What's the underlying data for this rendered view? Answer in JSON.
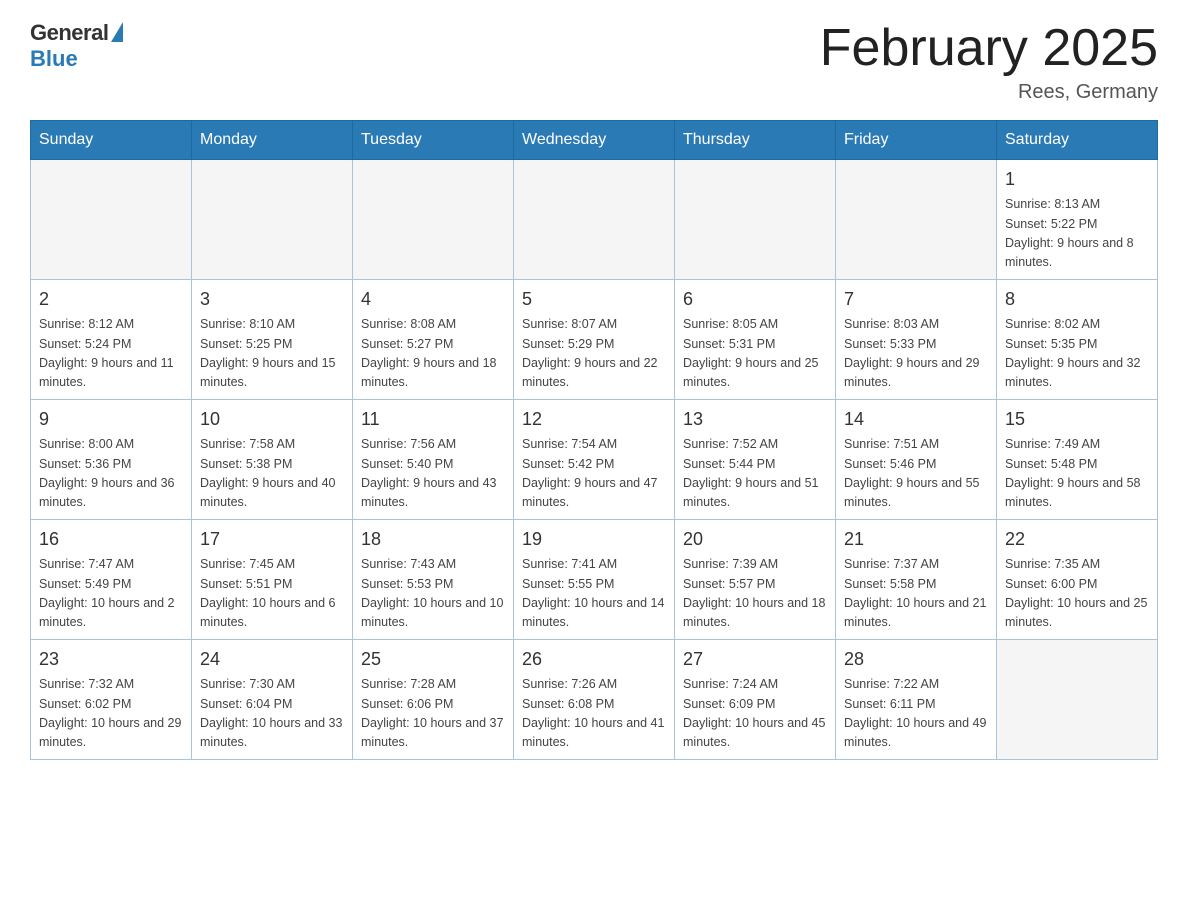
{
  "header": {
    "logo_general": "General",
    "logo_blue": "Blue",
    "month_title": "February 2025",
    "location": "Rees, Germany"
  },
  "weekdays": [
    "Sunday",
    "Monday",
    "Tuesday",
    "Wednesday",
    "Thursday",
    "Friday",
    "Saturday"
  ],
  "weeks": [
    [
      {
        "day": "",
        "info": ""
      },
      {
        "day": "",
        "info": ""
      },
      {
        "day": "",
        "info": ""
      },
      {
        "day": "",
        "info": ""
      },
      {
        "day": "",
        "info": ""
      },
      {
        "day": "",
        "info": ""
      },
      {
        "day": "1",
        "info": "Sunrise: 8:13 AM\nSunset: 5:22 PM\nDaylight: 9 hours and 8 minutes."
      }
    ],
    [
      {
        "day": "2",
        "info": "Sunrise: 8:12 AM\nSunset: 5:24 PM\nDaylight: 9 hours and 11 minutes."
      },
      {
        "day": "3",
        "info": "Sunrise: 8:10 AM\nSunset: 5:25 PM\nDaylight: 9 hours and 15 minutes."
      },
      {
        "day": "4",
        "info": "Sunrise: 8:08 AM\nSunset: 5:27 PM\nDaylight: 9 hours and 18 minutes."
      },
      {
        "day": "5",
        "info": "Sunrise: 8:07 AM\nSunset: 5:29 PM\nDaylight: 9 hours and 22 minutes."
      },
      {
        "day": "6",
        "info": "Sunrise: 8:05 AM\nSunset: 5:31 PM\nDaylight: 9 hours and 25 minutes."
      },
      {
        "day": "7",
        "info": "Sunrise: 8:03 AM\nSunset: 5:33 PM\nDaylight: 9 hours and 29 minutes."
      },
      {
        "day": "8",
        "info": "Sunrise: 8:02 AM\nSunset: 5:35 PM\nDaylight: 9 hours and 32 minutes."
      }
    ],
    [
      {
        "day": "9",
        "info": "Sunrise: 8:00 AM\nSunset: 5:36 PM\nDaylight: 9 hours and 36 minutes."
      },
      {
        "day": "10",
        "info": "Sunrise: 7:58 AM\nSunset: 5:38 PM\nDaylight: 9 hours and 40 minutes."
      },
      {
        "day": "11",
        "info": "Sunrise: 7:56 AM\nSunset: 5:40 PM\nDaylight: 9 hours and 43 minutes."
      },
      {
        "day": "12",
        "info": "Sunrise: 7:54 AM\nSunset: 5:42 PM\nDaylight: 9 hours and 47 minutes."
      },
      {
        "day": "13",
        "info": "Sunrise: 7:52 AM\nSunset: 5:44 PM\nDaylight: 9 hours and 51 minutes."
      },
      {
        "day": "14",
        "info": "Sunrise: 7:51 AM\nSunset: 5:46 PM\nDaylight: 9 hours and 55 minutes."
      },
      {
        "day": "15",
        "info": "Sunrise: 7:49 AM\nSunset: 5:48 PM\nDaylight: 9 hours and 58 minutes."
      }
    ],
    [
      {
        "day": "16",
        "info": "Sunrise: 7:47 AM\nSunset: 5:49 PM\nDaylight: 10 hours and 2 minutes."
      },
      {
        "day": "17",
        "info": "Sunrise: 7:45 AM\nSunset: 5:51 PM\nDaylight: 10 hours and 6 minutes."
      },
      {
        "day": "18",
        "info": "Sunrise: 7:43 AM\nSunset: 5:53 PM\nDaylight: 10 hours and 10 minutes."
      },
      {
        "day": "19",
        "info": "Sunrise: 7:41 AM\nSunset: 5:55 PM\nDaylight: 10 hours and 14 minutes."
      },
      {
        "day": "20",
        "info": "Sunrise: 7:39 AM\nSunset: 5:57 PM\nDaylight: 10 hours and 18 minutes."
      },
      {
        "day": "21",
        "info": "Sunrise: 7:37 AM\nSunset: 5:58 PM\nDaylight: 10 hours and 21 minutes."
      },
      {
        "day": "22",
        "info": "Sunrise: 7:35 AM\nSunset: 6:00 PM\nDaylight: 10 hours and 25 minutes."
      }
    ],
    [
      {
        "day": "23",
        "info": "Sunrise: 7:32 AM\nSunset: 6:02 PM\nDaylight: 10 hours and 29 minutes."
      },
      {
        "day": "24",
        "info": "Sunrise: 7:30 AM\nSunset: 6:04 PM\nDaylight: 10 hours and 33 minutes."
      },
      {
        "day": "25",
        "info": "Sunrise: 7:28 AM\nSunset: 6:06 PM\nDaylight: 10 hours and 37 minutes."
      },
      {
        "day": "26",
        "info": "Sunrise: 7:26 AM\nSunset: 6:08 PM\nDaylight: 10 hours and 41 minutes."
      },
      {
        "day": "27",
        "info": "Sunrise: 7:24 AM\nSunset: 6:09 PM\nDaylight: 10 hours and 45 minutes."
      },
      {
        "day": "28",
        "info": "Sunrise: 7:22 AM\nSunset: 6:11 PM\nDaylight: 10 hours and 49 minutes."
      },
      {
        "day": "",
        "info": ""
      }
    ]
  ]
}
